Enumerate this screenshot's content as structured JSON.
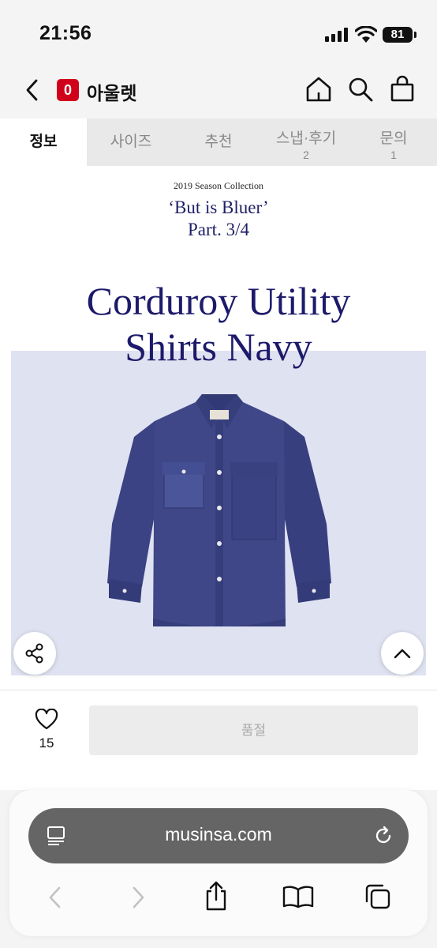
{
  "status_bar": {
    "time": "21:56",
    "battery": "81"
  },
  "nav": {
    "logo_text": "0",
    "title": "아울렛"
  },
  "tabs": [
    {
      "label": "정보",
      "count": ""
    },
    {
      "label": "사이즈",
      "count": ""
    },
    {
      "label": "추천",
      "count": ""
    },
    {
      "label": "스냅·후기",
      "count": "2"
    },
    {
      "label": "문의",
      "count": "1"
    }
  ],
  "content": {
    "season": "2019 Season Collection",
    "subtitle1": "‘But is Bluer’",
    "subtitle2": "Part. 3/4",
    "headline1": "Corduroy Utility",
    "headline2": "Shirts Navy"
  },
  "actions": {
    "like_count": "15",
    "soldout_label": "품절"
  },
  "browser": {
    "url": "musinsa.com"
  },
  "colors": {
    "accent_red": "#d0021b",
    "navy_text": "#1d1a6b",
    "shirt": "#3b4384",
    "product_bg": "#dfe2f1"
  }
}
